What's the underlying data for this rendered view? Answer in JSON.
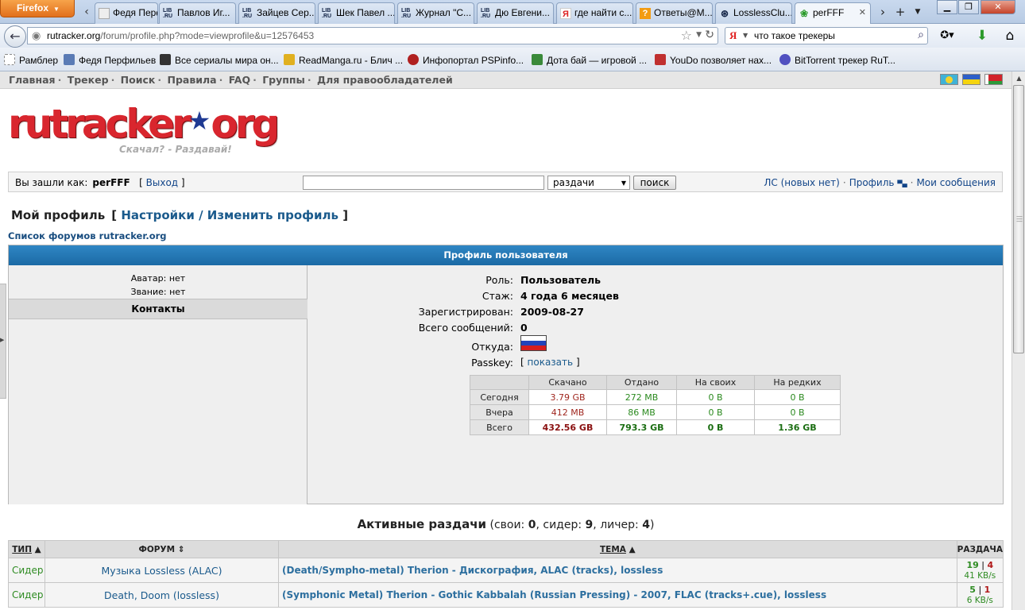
{
  "browser": {
    "app_button": "Firefox",
    "tabs": [
      {
        "label": "Федя Перф...",
        "icon": "tab-favicon-generic"
      },
      {
        "label": "Павлов Иг...",
        "icon": "lib-ru-icon"
      },
      {
        "label": "Зайцев Сер...",
        "icon": "lib-ru-icon"
      },
      {
        "label": "Шек Павел ...",
        "icon": "lib-ru-icon"
      },
      {
        "label": "Журнал \"С...",
        "icon": "lib-ru-icon"
      },
      {
        "label": "Дю Евгени...",
        "icon": "lib-ru-icon"
      },
      {
        "label": "где найти с...",
        "icon": "yandex-icon"
      },
      {
        "label": "Ответы@М...",
        "icon": "question-icon"
      },
      {
        "label": "LosslessClu...",
        "icon": "lossless-icon"
      },
      {
        "label": "perFFF",
        "icon": "rutracker-icon",
        "active": true
      }
    ],
    "url_domain": "rutracker.org",
    "url_path": "/forum/profile.php?mode=viewprofile&u=12576453",
    "search_query": "что такое трекеры",
    "search_engine": "Я",
    "bookmarks": [
      {
        "label": "Рамблер",
        "color": "#ffffff"
      },
      {
        "label": "Федя Перфильев",
        "color": "#5a7bb5"
      },
      {
        "label": "Все сериалы мира он...",
        "color": "#333333"
      },
      {
        "label": "ReadManga.ru - Блич ...",
        "color": "#e0b020"
      },
      {
        "label": "Инфопортал PSPinfo...",
        "color": "#b02020"
      },
      {
        "label": "Дота бай — игровой ...",
        "color": "#3a8a3a"
      },
      {
        "label": "YouDo позволяет нах...",
        "color": "#c03030"
      },
      {
        "label": "BitTorrent трекер RuT...",
        "color": "#5050c0"
      }
    ]
  },
  "site": {
    "nav": [
      "Главная",
      "Трекер",
      "Поиск",
      "Правила",
      "FAQ",
      "Группы",
      "Для правообладателей"
    ],
    "logo_text": "rutracker",
    "logo_org": "org",
    "slogan": "Скачал? - Раздавай!",
    "login_label": "Вы зашли как:",
    "username": "perFFF",
    "logout": "Выход",
    "search_select": "раздачи",
    "search_button": "поиск",
    "pm_link": "ЛС (новых нет)",
    "profile_link": "Профиль",
    "my_posts_link": "Мои сообщения"
  },
  "profile": {
    "title": "Мой профиль",
    "settings_link": "Настройки / Изменить профиль",
    "forum_list_link": "Список форумов rutracker.org",
    "box_header": "Профиль пользователя",
    "avatar_line": "Аватар: нет",
    "rank_line": "Звание: нет",
    "contacts": "Контакты",
    "fields": [
      {
        "key": "Роль:",
        "value": "Пользователь"
      },
      {
        "key": "Стаж:",
        "value": "4 года 6 месяцев"
      },
      {
        "key": "Зарегистрирован:",
        "value": "2009-08-27"
      },
      {
        "key": "Всего сообщений:",
        "value": "0"
      }
    ],
    "from_label": "Откуда:",
    "passkey_label": "Passkey:",
    "passkey_link": "показать"
  },
  "stats": {
    "headers": [
      "",
      "Скачано",
      "Отдано",
      "На своих",
      "На редких"
    ],
    "rows": [
      {
        "label": "Сегодня",
        "down": "3.79 GB",
        "up": "272 MB",
        "own": "0 B",
        "rare": "0 B"
      },
      {
        "label": "Вчера",
        "down": "412 MB",
        "up": "86 MB",
        "own": "0 B",
        "rare": "0 B"
      },
      {
        "label": "Всего",
        "down": "432.56 GB",
        "up": "793.3 GB",
        "own": "0 B",
        "rare": "1.36 GB"
      }
    ]
  },
  "active": {
    "title": "Активные раздачи",
    "own_label": "свои:",
    "own": "0",
    "seed_label": "сидер:",
    "seed": "9",
    "leech_label": "личер:",
    "leech": "4",
    "headers": {
      "type": "ТИП",
      "forum": "ФОРУМ",
      "topic": "ТЕМА",
      "seeding": "РАЗДАЧА"
    },
    "rows": [
      {
        "type": "Сидер",
        "forum": "Музыка Lossless (ALAC)",
        "topic": "(Death/Sympho-metal) Therion - Дискография, ALAC (tracks), lossless",
        "seeders": "19",
        "leechers": "4",
        "speed": "41 KB/s"
      },
      {
        "type": "Сидер",
        "forum": "Death, Doom (lossless)",
        "topic": "(Symphonic Metal) Therion - Gothic Kabbalah (Russian Pressing) - 2007, FLAC (tracks+.cue), lossless",
        "seeders": "5",
        "leechers": "1",
        "speed": "6 KB/s"
      }
    ]
  }
}
